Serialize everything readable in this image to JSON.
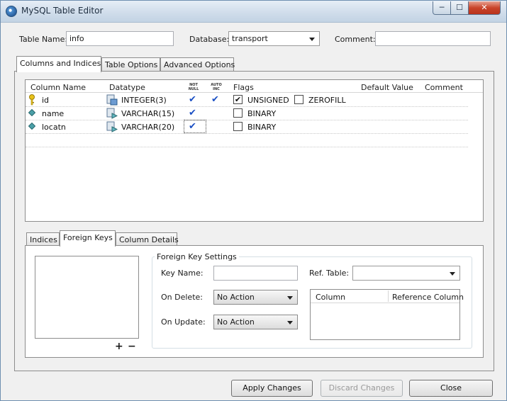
{
  "window": {
    "title": "MySQL Table Editor"
  },
  "top": {
    "table_name_label": "Table Name:",
    "table_name_value": "info",
    "database_label": "Database:",
    "database_value": "transport",
    "comment_label": "Comment:",
    "comment_value": ""
  },
  "main_tabs": [
    "Columns and Indices",
    "Table Options",
    "Advanced Options"
  ],
  "columns_grid": {
    "headers": {
      "column_name": "Column Name",
      "datatype": "Datatype",
      "not_null_top": "NOT",
      "not_null_bottom": "NULL",
      "auto_inc_top": "AUTO",
      "auto_inc_bottom": "INC",
      "flags": "Flags",
      "default_value": "Default Value",
      "comment": "Comment"
    },
    "rows": [
      {
        "name": "id",
        "datatype": "INTEGER(3)",
        "not_null": true,
        "auto_inc": true,
        "flag1_label": "UNSIGNED",
        "flag1_checked": true,
        "flag2_label": "ZEROFILL",
        "flag2_checked": false,
        "icon": "primary-key-icon"
      },
      {
        "name": "name",
        "datatype": "VARCHAR(15)",
        "not_null": true,
        "auto_inc": false,
        "flag1_label": "BINARY",
        "flag1_checked": false,
        "icon": "column-diamond-icon"
      },
      {
        "name": "locatn",
        "datatype": "VARCHAR(20)",
        "not_null": true,
        "auto_inc": false,
        "flag1_label": "BINARY",
        "flag1_checked": false,
        "icon": "column-diamond-icon"
      }
    ]
  },
  "sub_tabs": [
    "Indices",
    "Foreign Keys",
    "Column Details"
  ],
  "foreign_keys": {
    "group_title": "Foreign Key Settings",
    "key_name_label": "Key Name:",
    "key_name_value": "",
    "ref_table_label": "Ref. Table:",
    "ref_table_value": "",
    "on_delete_label": "On Delete:",
    "on_delete_value": "No Action",
    "on_update_label": "On Update:",
    "on_update_value": "No Action",
    "ref_grid_headers": [
      "Column",
      "Reference Column"
    ],
    "add_symbol": "+",
    "remove_symbol": "−"
  },
  "buttons": {
    "apply": "Apply Changes",
    "discard": "Discard Changes",
    "close": "Close"
  },
  "colors": {
    "check": "#1a4fc4",
    "key_icon": "#e8c21a",
    "diamond_icon": "#4aa0a8"
  }
}
